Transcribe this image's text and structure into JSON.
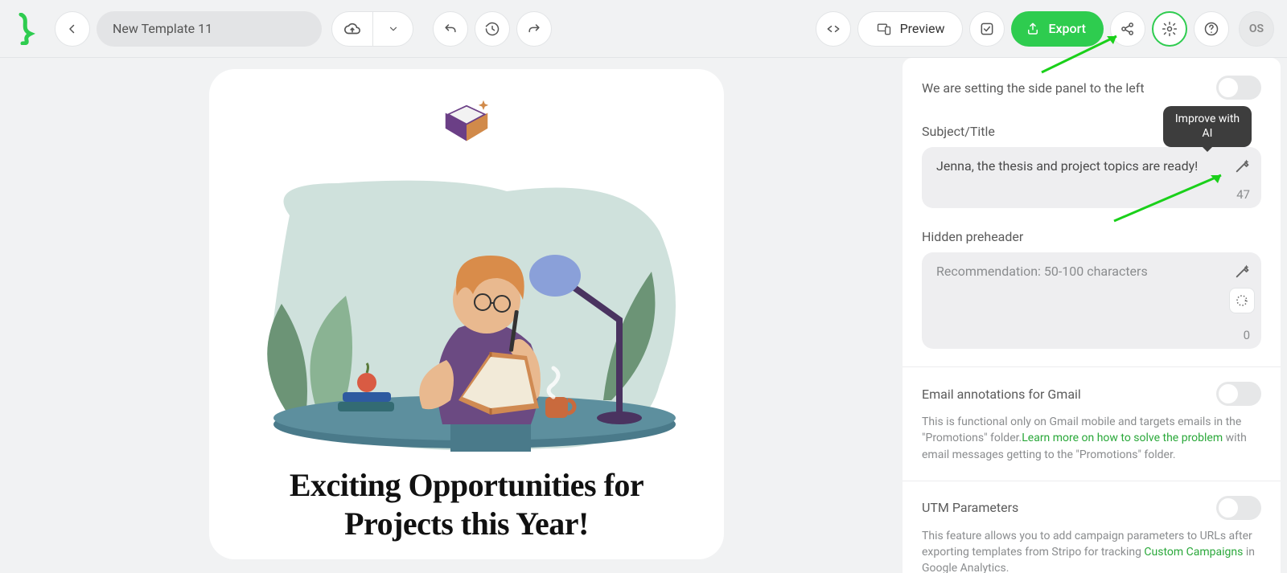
{
  "toolbar": {
    "template_name": "New Template 11",
    "preview_label": "Preview",
    "export_label": "Export",
    "avatar_initials": "OS"
  },
  "canvas": {
    "heading": "Exciting Opportunities for Projects this Year!"
  },
  "panel": {
    "side_panel_left_label": "We are setting the side panel to the left",
    "subject_label": "Subject/Title",
    "subject_value": "Jenna, the thesis and project topics are ready!",
    "subject_count": "47",
    "preheader_label": "Hidden preheader",
    "preheader_placeholder": "Recommendation: 50-100 characters",
    "preheader_count": "0",
    "gmail_annotations_label": "Email annotations for Gmail",
    "gmail_help_1": "This is functional only on Gmail mobile and targets emails in the \"Promotions\" folder.",
    "gmail_help_link": "Learn more on how to solve the problem",
    "gmail_help_2": " with email messages getting to the \"Promotions\" folder.",
    "utm_label": "UTM Parameters",
    "utm_help_1": "This feature allows you to add campaign parameters to URLs after exporting templates from Stripo for tracking ",
    "utm_help_link": "Custom Campaigns",
    "utm_help_2": " in Google Analytics."
  },
  "tooltip": {
    "ai_improve": "Improve with AI"
  },
  "icons": {
    "back": "←",
    "cloud": "☁",
    "chevron_down": "▾",
    "undo": "↶",
    "history": "⟳",
    "redo": "↷",
    "code": "</>",
    "devices": "⧉",
    "checklist": "☑",
    "upload": "⇪",
    "share": "∞",
    "gear": "⚙",
    "help": "?",
    "wand": "✦",
    "spinner": "◌"
  }
}
